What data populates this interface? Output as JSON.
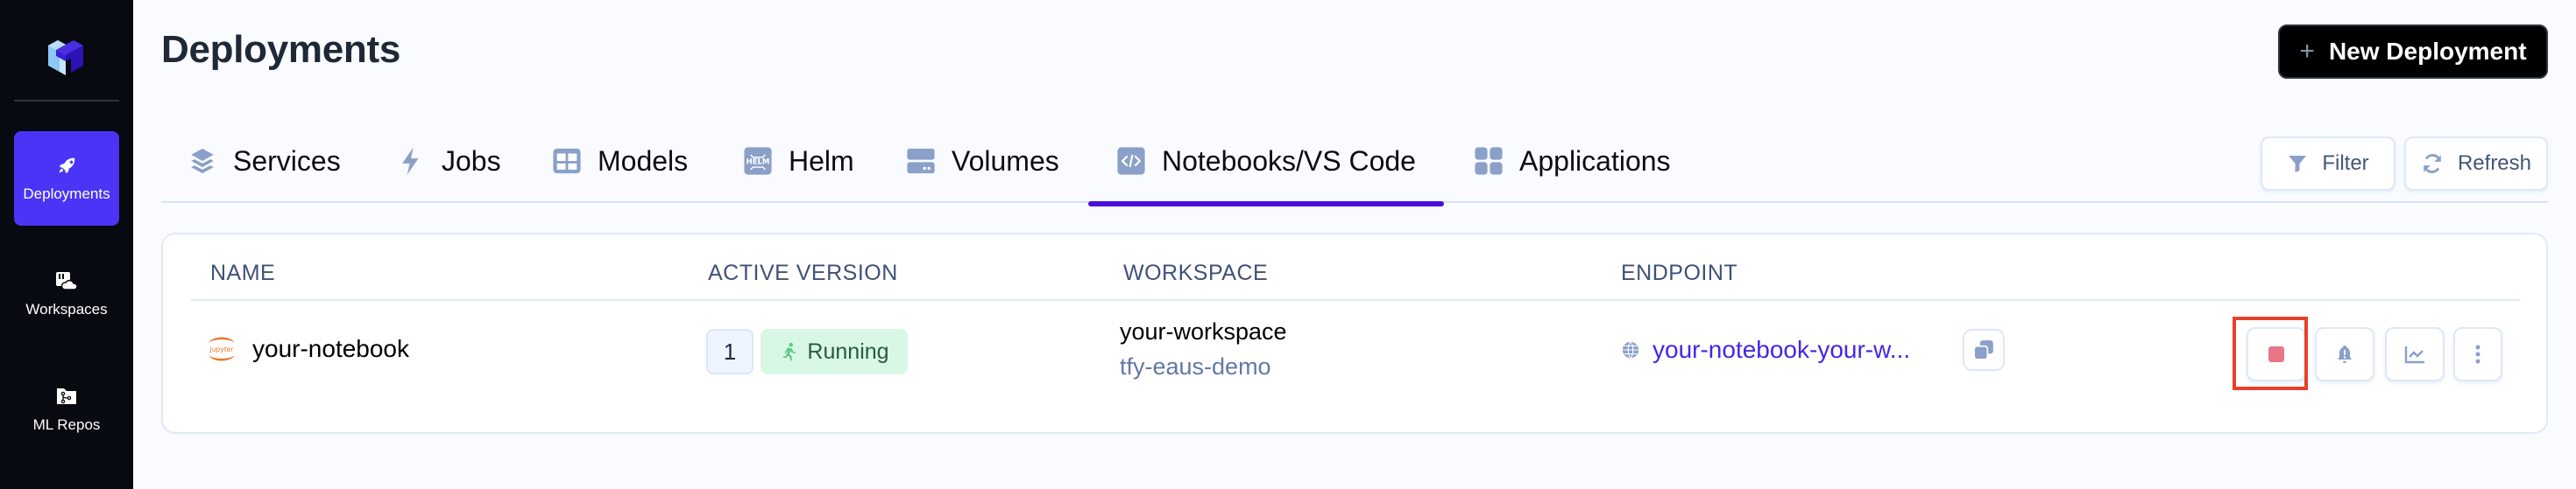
{
  "sidebar": {
    "logo": "truefoundry-cube-logo",
    "items": [
      {
        "label": "Deployments",
        "icon": "rocket-icon",
        "active": true
      },
      {
        "label": "Workspaces",
        "icon": "workspace-cloud-icon",
        "active": false
      },
      {
        "label": "ML Repos",
        "icon": "repo-folder-icon",
        "active": false
      }
    ]
  },
  "header": {
    "title": "Deployments",
    "new_button": {
      "icon": "plus-icon",
      "label": "New Deployment"
    }
  },
  "tabs": [
    {
      "label": "Services",
      "icon": "layers-icon",
      "active": false
    },
    {
      "label": "Jobs",
      "icon": "lightning-icon",
      "active": false
    },
    {
      "label": "Models",
      "icon": "grid-box-icon",
      "active": false
    },
    {
      "label": "Helm",
      "icon": "helm-icon",
      "active": false
    },
    {
      "label": "Volumes",
      "icon": "volume-icon",
      "active": false
    },
    {
      "label": "Notebooks/VS Code",
      "icon": "code-icon",
      "active": true
    },
    {
      "label": "Applications",
      "icon": "apps-grid-icon",
      "active": false
    }
  ],
  "toolbar": {
    "filter_label": "Filter",
    "refresh_label": "Refresh"
  },
  "table": {
    "columns": [
      "NAME",
      "ACTIVE VERSION",
      "WORKSPACE",
      "ENDPOINT"
    ],
    "rows": [
      {
        "icon": "jupyter-icon",
        "name": "your-notebook",
        "version": "1",
        "status": "Running",
        "workspace": "your-workspace",
        "cluster": "tfy-eaus-demo",
        "endpoint": "your-notebook-your-w...",
        "actions": [
          "stop",
          "alerts",
          "metrics",
          "more"
        ]
      }
    ]
  },
  "colors": {
    "accent": "#4a10d8",
    "sidebar_active": "#4b34f5",
    "status_running_bg": "#d8f7e5",
    "stop_icon": "#e87686",
    "highlight": "#e8412a"
  }
}
